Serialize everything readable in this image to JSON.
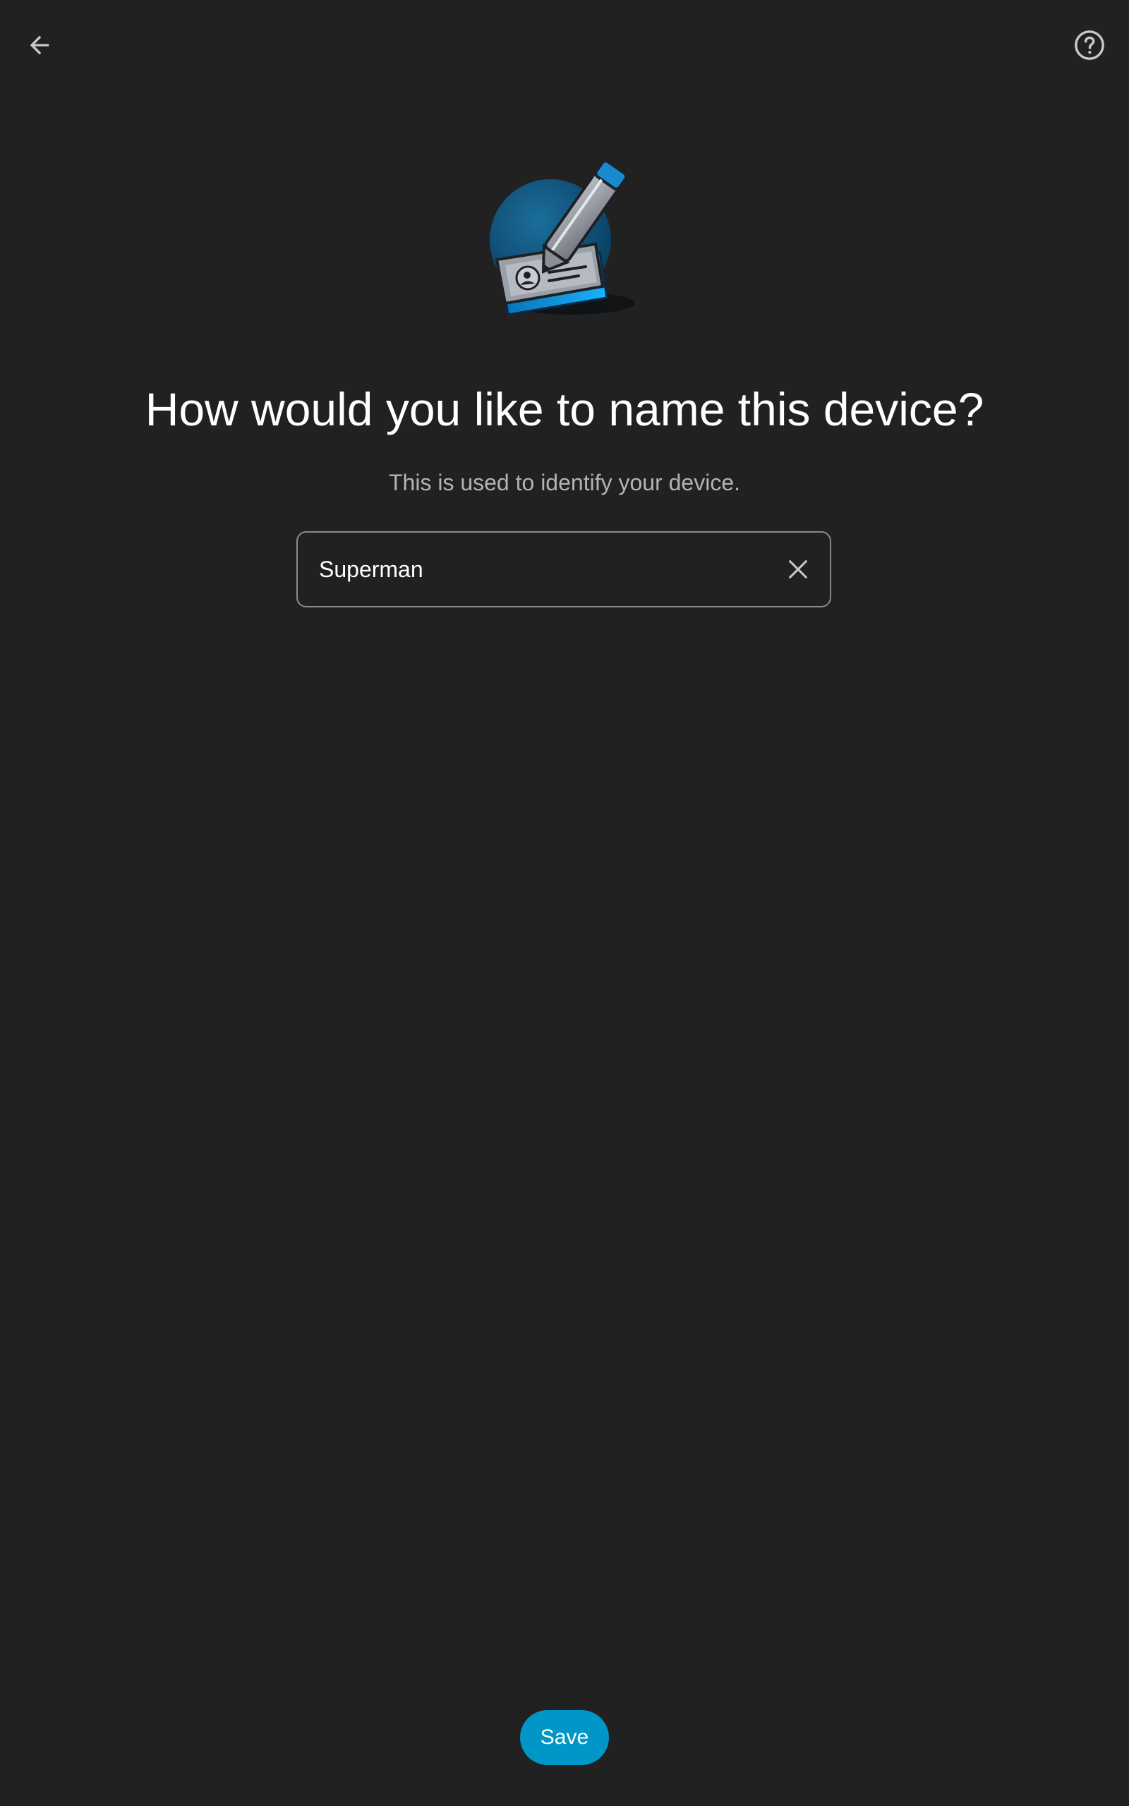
{
  "header": {
    "back_icon": "arrow-left-icon",
    "help_icon": "help-circle-icon"
  },
  "hero": {
    "icon": "pencil-id-card-illustration"
  },
  "content": {
    "title": "How would you like to name this device?",
    "subtitle": "This is used to identify your device."
  },
  "name_field": {
    "value": "Superman",
    "clear_icon": "close-icon"
  },
  "footer": {
    "save_label": "Save"
  },
  "colors": {
    "background": "#212121",
    "accent": "#0096c7",
    "text_primary": "#ffffff",
    "text_secondary": "#b3b3b3"
  }
}
